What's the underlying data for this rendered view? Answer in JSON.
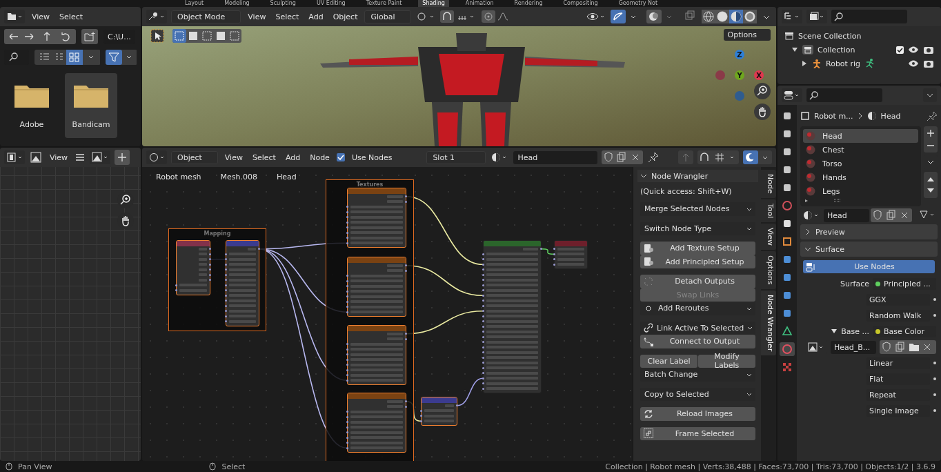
{
  "workspace_tabs": [
    {
      "label": "Layout",
      "selected": false
    },
    {
      "label": "Modeling",
      "selected": false
    },
    {
      "label": "Sculpting",
      "selected": false
    },
    {
      "label": "UV Editing",
      "selected": false
    },
    {
      "label": "Texture Paint",
      "selected": false
    },
    {
      "label": "Shading",
      "selected": true
    },
    {
      "label": "Animation",
      "selected": false
    },
    {
      "label": "Rendering",
      "selected": false
    },
    {
      "label": "Compositing",
      "selected": false
    },
    {
      "label": "Geometry Not",
      "selected": false
    }
  ],
  "file_browser": {
    "menus": [
      "View",
      "Select"
    ],
    "path": "C:\\U...",
    "folders": [
      {
        "name": "Adobe",
        "selected": false
      },
      {
        "name": "Bandicam",
        "selected": true
      }
    ]
  },
  "image_editor": {
    "menus": [
      "View"
    ]
  },
  "viewport": {
    "mode": "Object Mode",
    "menus": [
      "View",
      "Select",
      "Add",
      "Object"
    ],
    "orientation": "Global",
    "options": "Options",
    "shading_modes": [
      {
        "kind": "wireframe",
        "selected": false
      },
      {
        "kind": "solid",
        "selected": false
      },
      {
        "kind": "material",
        "selected": true
      },
      {
        "kind": "rendered",
        "selected": false
      }
    ],
    "gizmo_axes": [
      {
        "label": "Z",
        "color": "#2e7fd6"
      },
      {
        "label": "Y",
        "color": "#6ea61e"
      },
      {
        "label": "X",
        "color": "#e0374f"
      }
    ]
  },
  "node_editor": {
    "mode": "Object",
    "menus": [
      "View",
      "Select",
      "Add",
      "Node"
    ],
    "use_nodes": {
      "label": "Use Nodes",
      "checked": true
    },
    "slot": "Slot 1",
    "material": "Head",
    "breadcrumbs": [
      "Robot mesh",
      "Mesh.008",
      "Head"
    ],
    "frames": [
      {
        "label": "Mapping",
        "selected": true
      },
      {
        "label": "Textures",
        "selected": true
      }
    ],
    "nodes": [
      {
        "kind": "input",
        "selected": true
      },
      {
        "kind": "vector",
        "selected": true
      },
      {
        "kind": "texture",
        "selected": true
      },
      {
        "kind": "texture",
        "selected": true
      },
      {
        "kind": "texture",
        "selected": true
      },
      {
        "kind": "texture",
        "selected": true
      },
      {
        "kind": "vector",
        "selected": true
      },
      {
        "kind": "shader",
        "selected": false
      },
      {
        "kind": "output",
        "selected": false
      }
    ]
  },
  "sidebar": {
    "title": "Node Wrangler",
    "expanded": true,
    "hint": "(Quick access: Shift+W)",
    "groups": [
      [
        {
          "kind": "menu",
          "label": "Merge Selected Nodes",
          "disabled": false
        }
      ],
      [
        {
          "kind": "menu",
          "label": "Switch Node Type",
          "disabled": false
        }
      ],
      [
        {
          "kind": "button",
          "label": "Add Texture Setup",
          "disabled": false
        },
        {
          "kind": "button",
          "label": "Add Principled Setup",
          "disabled": false
        }
      ],
      [
        {
          "kind": "button",
          "label": "Detach Outputs",
          "disabled": false
        },
        {
          "kind": "button",
          "label": "Swap Links",
          "disabled": true
        },
        {
          "kind": "menu",
          "label": "Add Reroutes",
          "disabled": false
        }
      ],
      [
        {
          "kind": "menu",
          "label": "Link Active To Selected",
          "disabled": false
        },
        {
          "kind": "button",
          "label": "Connect to Output",
          "disabled": false
        }
      ],
      [
        {
          "kind": "pair",
          "labels": [
            "Clear Label",
            "Modify Labels"
          ],
          "disabled": false
        },
        {
          "kind": "menu",
          "label": "Batch Change",
          "disabled": false
        }
      ],
      [
        {
          "kind": "menu",
          "label": "Copy to Selected",
          "disabled": false
        }
      ],
      [
        {
          "kind": "button",
          "label": "Reload Images",
          "disabled": false
        }
      ],
      [
        {
          "kind": "button",
          "label": "Frame Selected",
          "disabled": false
        }
      ]
    ]
  },
  "sidebar_tabs": [
    {
      "label": "Node",
      "selected": false
    },
    {
      "label": "Tool",
      "selected": false
    },
    {
      "label": "View",
      "selected": false
    },
    {
      "label": "Options",
      "selected": false
    },
    {
      "label": "Node Wrangler",
      "selected": true
    }
  ],
  "outliner": {
    "items": [
      {
        "label": "Scene Collection",
        "children": [
          {
            "label": "Collection",
            "expanded": true,
            "checked": true,
            "children": [
              {
                "label": "Robot rig",
                "expanded": false
              }
            ]
          }
        ]
      }
    ]
  },
  "properties": {
    "tabs": [
      {
        "kind": "tool",
        "selected": false
      },
      {
        "kind": "render",
        "selected": false
      },
      {
        "kind": "output",
        "selected": false
      },
      {
        "kind": "view_layer",
        "selected": false
      },
      {
        "kind": "scene",
        "selected": false
      },
      {
        "kind": "world",
        "selected": false
      },
      {
        "kind": "collection",
        "selected": false
      },
      {
        "kind": "object",
        "selected": false
      },
      {
        "kind": "modifier",
        "selected": false
      },
      {
        "kind": "particles",
        "selected": false
      },
      {
        "kind": "physics",
        "selected": false
      },
      {
        "kind": "constraints",
        "selected": false
      },
      {
        "kind": "data",
        "selected": false
      },
      {
        "kind": "material",
        "selected": true
      },
      {
        "kind": "texture",
        "selected": false
      }
    ],
    "breadcrumbs": [
      "Robot m...",
      "Head"
    ],
    "slots": [
      {
        "name": "Head",
        "selected": true
      },
      {
        "name": "Chest",
        "selected": false
      },
      {
        "name": "Torso",
        "selected": false
      },
      {
        "name": "Hands",
        "selected": false
      },
      {
        "name": "Legs",
        "selected": false
      }
    ],
    "material": "Head",
    "panels": [
      {
        "label": "Preview",
        "expanded": false
      },
      {
        "label": "Surface",
        "expanded": true
      }
    ],
    "use_nodes": "Use Nodes",
    "rows": [
      {
        "kind": "shader",
        "label": "Surface",
        "value": "Principled ...",
        "color": "#5fcf5f"
      },
      {
        "kind": "dropdown",
        "value": "GGX"
      },
      {
        "kind": "dropdown",
        "value": "Random Walk"
      },
      {
        "kind": "shader",
        "label": "Base ...",
        "value": "Base Color",
        "color": "#c7c729",
        "expanded": true
      },
      {
        "kind": "image",
        "value": "Head_B..."
      },
      {
        "kind": "dropdown",
        "value": "Linear"
      },
      {
        "kind": "dropdown",
        "value": "Flat"
      },
      {
        "kind": "dropdown",
        "value": "Repeat"
      },
      {
        "kind": "dropdown",
        "value": "Single Image"
      }
    ]
  },
  "status_bar": {
    "hints": [
      "Pan View",
      "Select"
    ],
    "info": "Collection | Robot mesh | Verts:38,488 | Faces:73,700 | Tris:73,700 | Objects:1/2 | 3.6.9"
  }
}
